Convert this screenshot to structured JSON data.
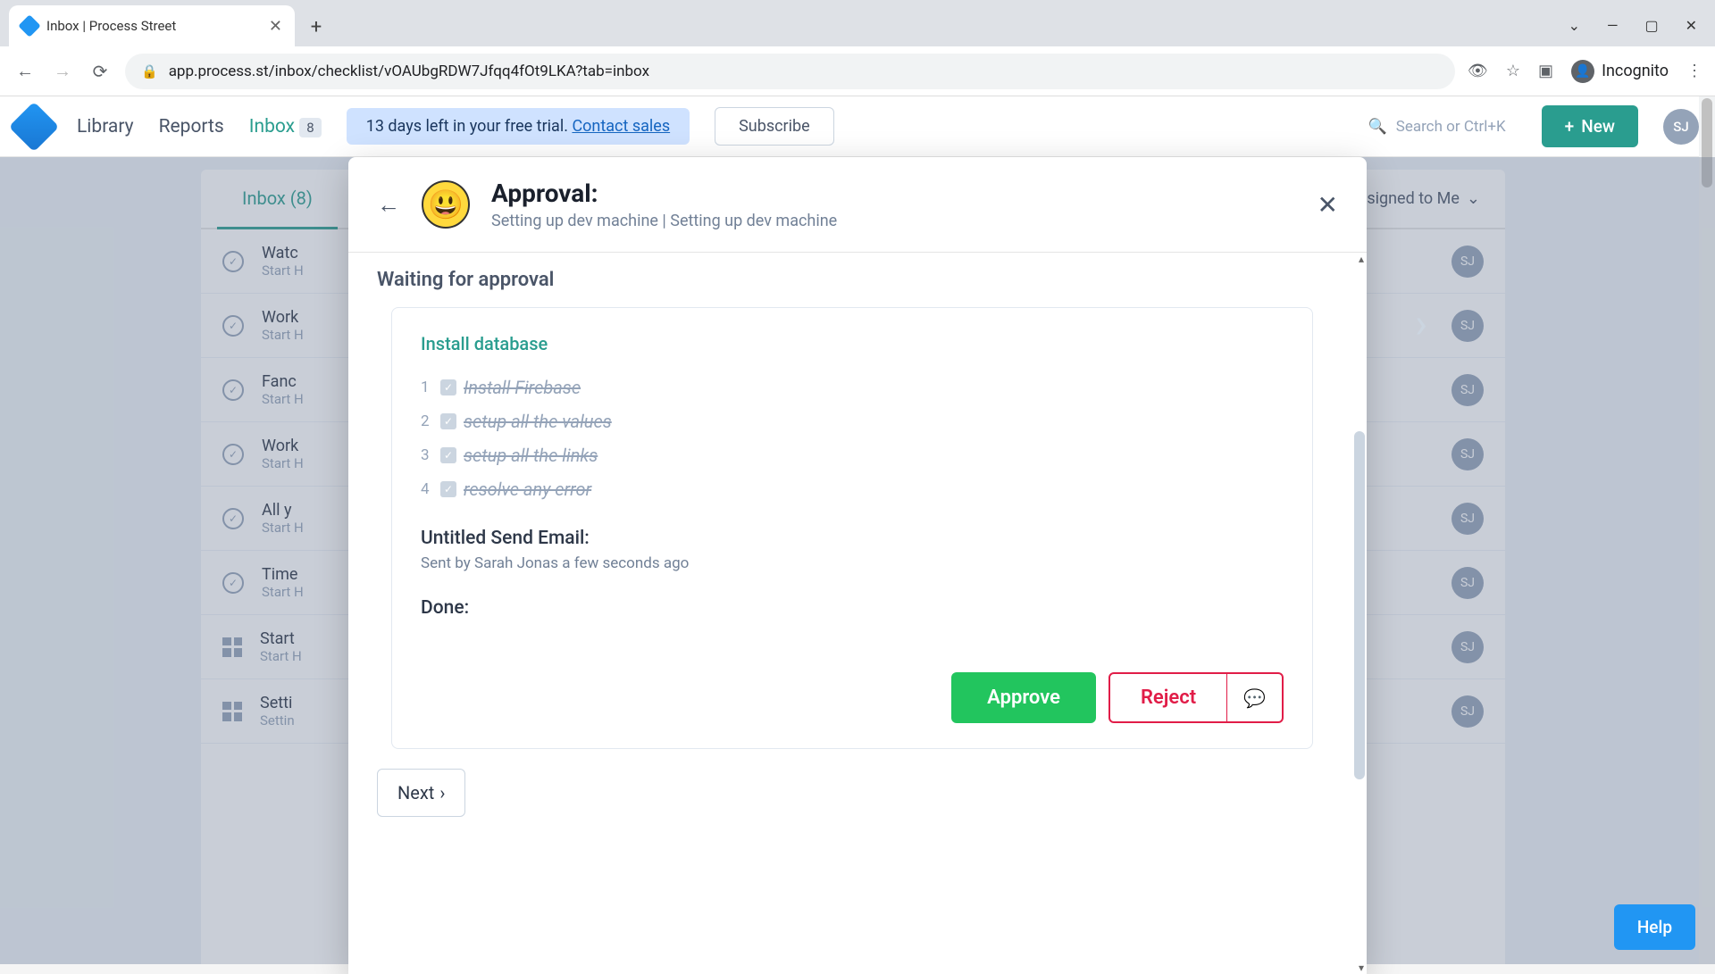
{
  "browser": {
    "tab_title": "Inbox | Process Street",
    "url": "app.process.st/inbox/checklist/vOAUbgRDW7Jfqq4fOt9LKA?tab=inbox",
    "incognito_label": "Incognito"
  },
  "header": {
    "nav": {
      "library": "Library",
      "reports": "Reports",
      "inbox": "Inbox",
      "inbox_count": "8"
    },
    "trial_text": "13 days left in your free trial.",
    "contact_sales": "Contact sales",
    "subscribe": "Subscribe",
    "search_placeholder": "Search or Ctrl+K",
    "new_button": "New",
    "avatar": "SJ"
  },
  "inbox": {
    "tab_label": "Inbox (8)",
    "filter_label": "Assigned to Me",
    "items": [
      {
        "title": "Watc",
        "sub": "Start H"
      },
      {
        "title": "Work",
        "sub": "Start H"
      },
      {
        "title": "Fanc",
        "sub": "Start H"
      },
      {
        "title": "Work",
        "sub": "Start H"
      },
      {
        "title": "All y",
        "sub": "Start H"
      },
      {
        "title": "Time",
        "sub": "Start H"
      },
      {
        "title": "Start",
        "sub": "Start H"
      },
      {
        "title": "Setti",
        "sub": "Settin"
      }
    ],
    "item_avatar": "SJ"
  },
  "modal": {
    "title": "Approval:",
    "subtitle": "Setting up dev machine | Setting up dev machine",
    "waiting_label": "Waiting for approval",
    "card_link": "Install database",
    "checklist": [
      {
        "n": "1",
        "label": "Install Firebase"
      },
      {
        "n": "2",
        "label": "setup all the values"
      },
      {
        "n": "3",
        "label": "setup all the links"
      },
      {
        "n": "4",
        "label": "resolve any error"
      }
    ],
    "email_title": "Untitled Send Email:",
    "email_sub": "Sent by Sarah Jonas a few seconds ago",
    "done_label": "Done:",
    "approve": "Approve",
    "reject": "Reject",
    "next": "Next"
  },
  "help": "Help"
}
